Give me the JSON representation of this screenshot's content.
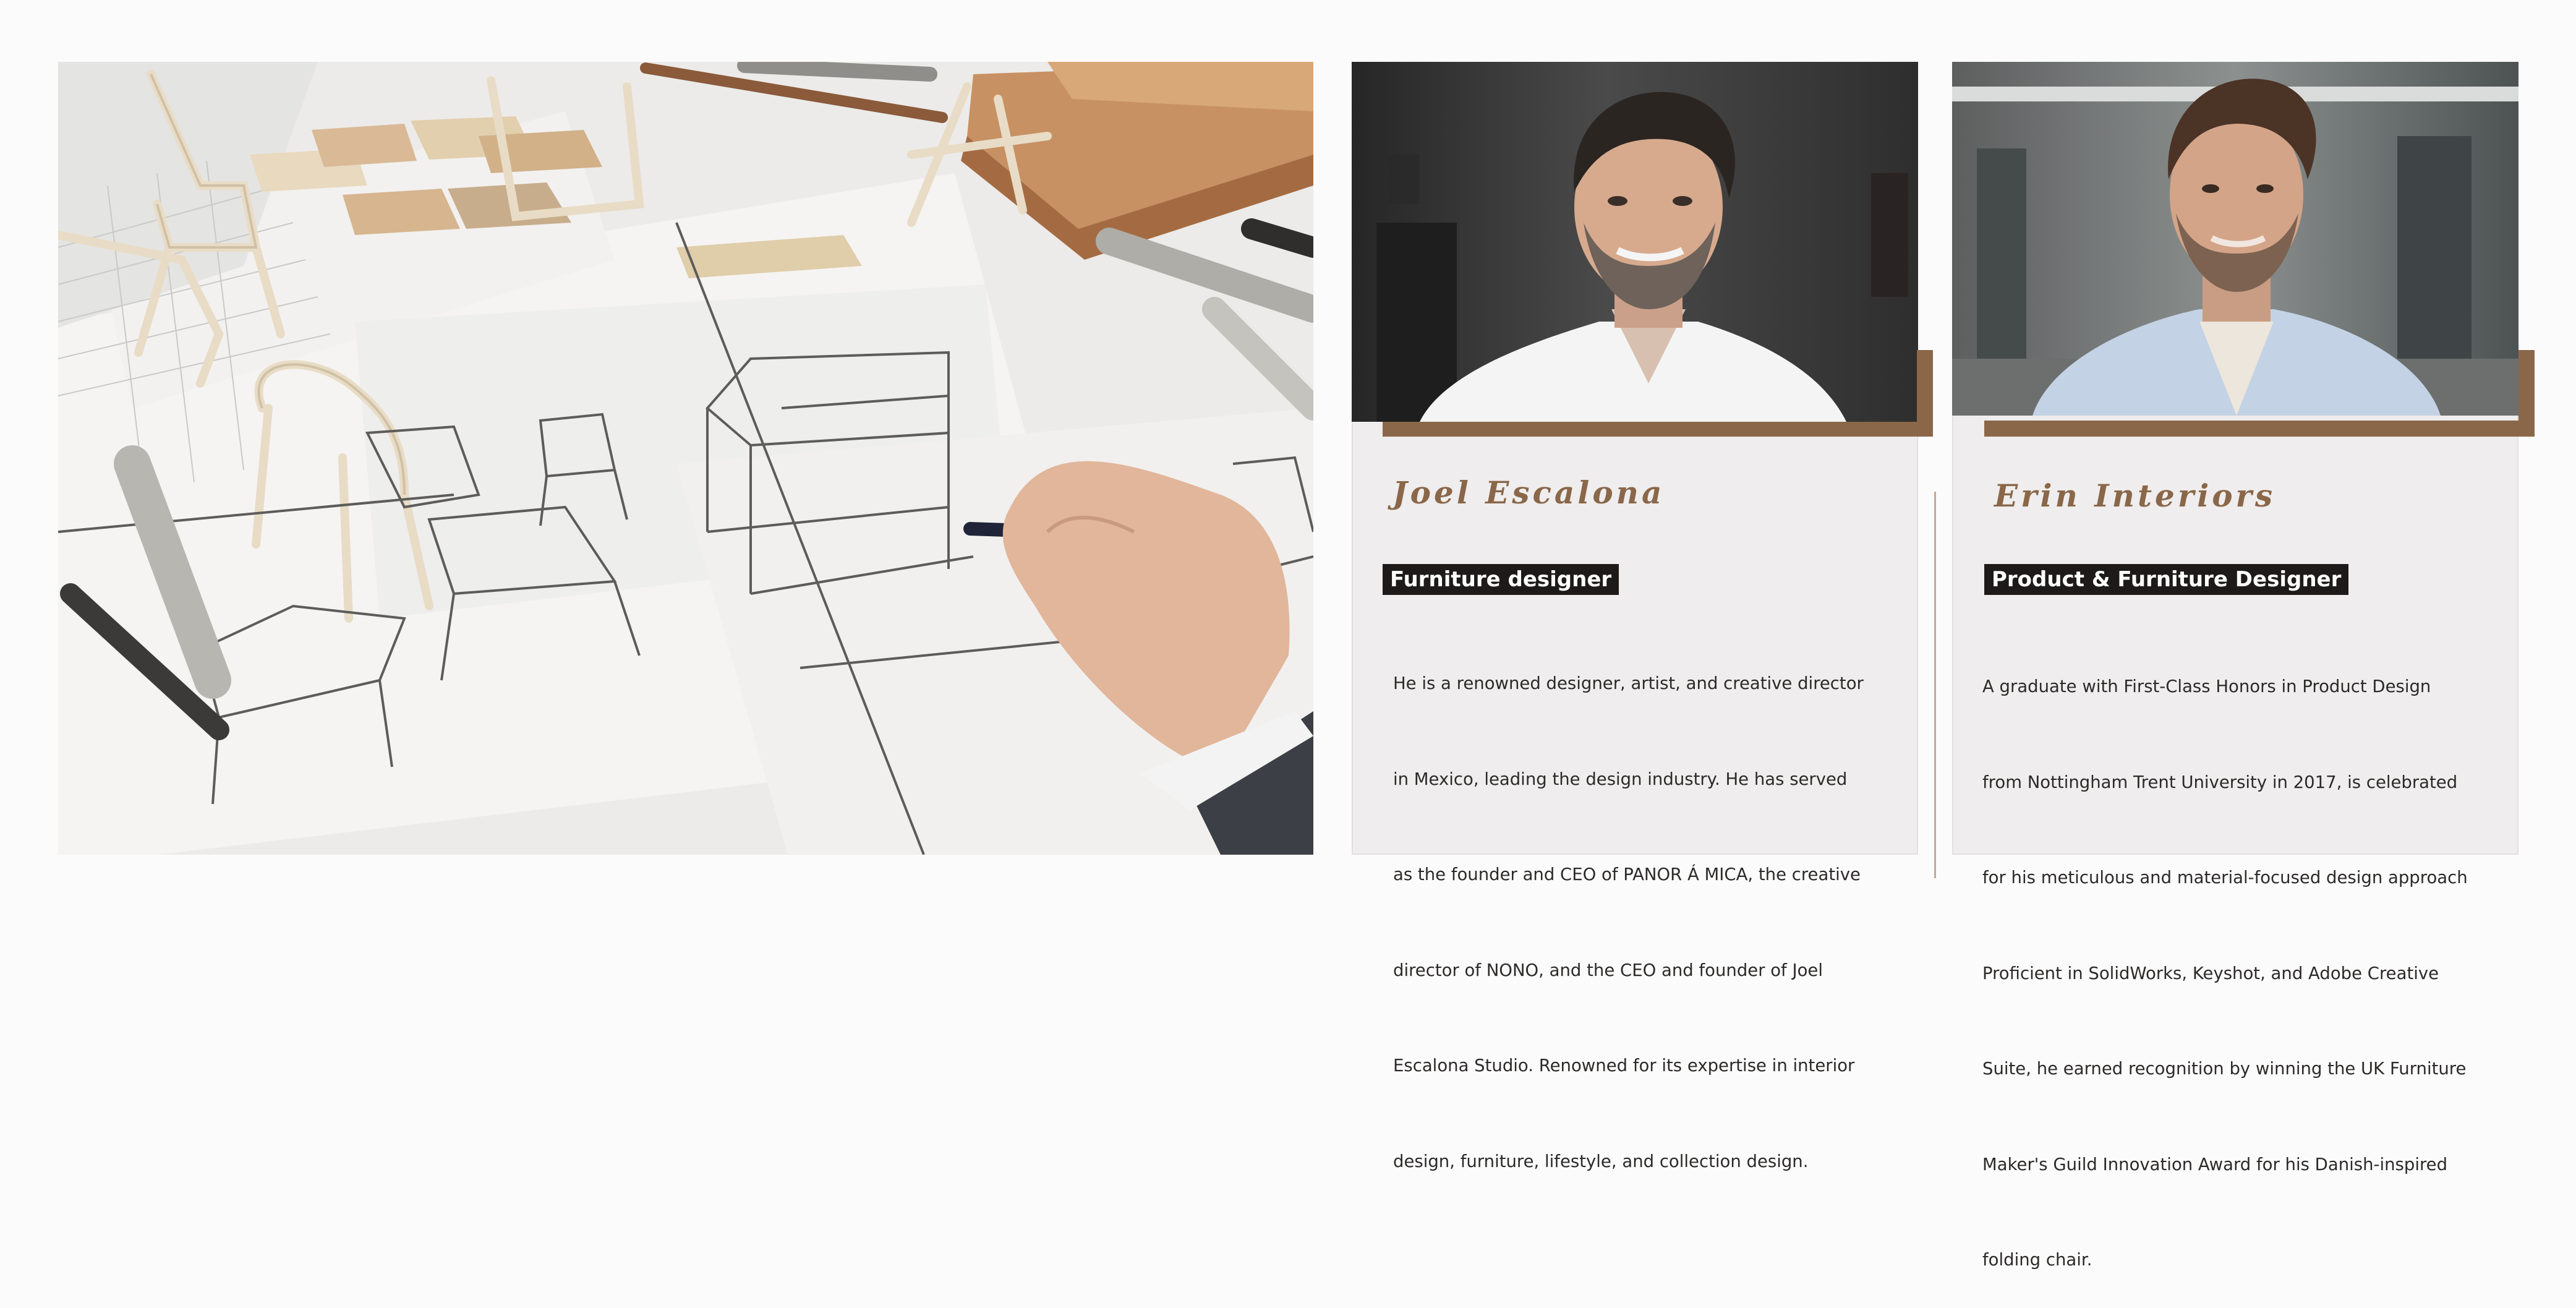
{
  "hero": {
    "icon": "furniture-sketch-illustration"
  },
  "designers": [
    {
      "name": "Joel Escalona",
      "role": "Furniture designer",
      "bio_lines": [
        "He is a renowned designer, artist, and creative director",
        "in Mexico, leading the design industry. He has served",
        "as the founder and CEO of PANOR Á MICA, the creative",
        "director of NONO, and the CEO and founder of Joel",
        "Escalona Studio. Renowned for its expertise in interior",
        "design, furniture, lifestyle, and collection design."
      ]
    },
    {
      "name": "Erin Interiors",
      "role": "Product & Furniture Designer",
      "bio_lines": [
        "A graduate with First-Class Honors in Product Design",
        "from Nottingham Trent University in 2017, is celebrated",
        "for his meticulous and material-focused design approach",
        "Proficient in SolidWorks, Keyshot, and Adobe Creative",
        "Suite, he earned recognition by winning the UK Furniture",
        "Maker's Guild Innovation Award for his Danish-inspired",
        "folding chair."
      ]
    }
  ],
  "colors": {
    "accent": "#8a6749",
    "card_bg": "#efeded",
    "badge_bg": "#1d1a19",
    "page_bg": "#fcfbfb"
  }
}
